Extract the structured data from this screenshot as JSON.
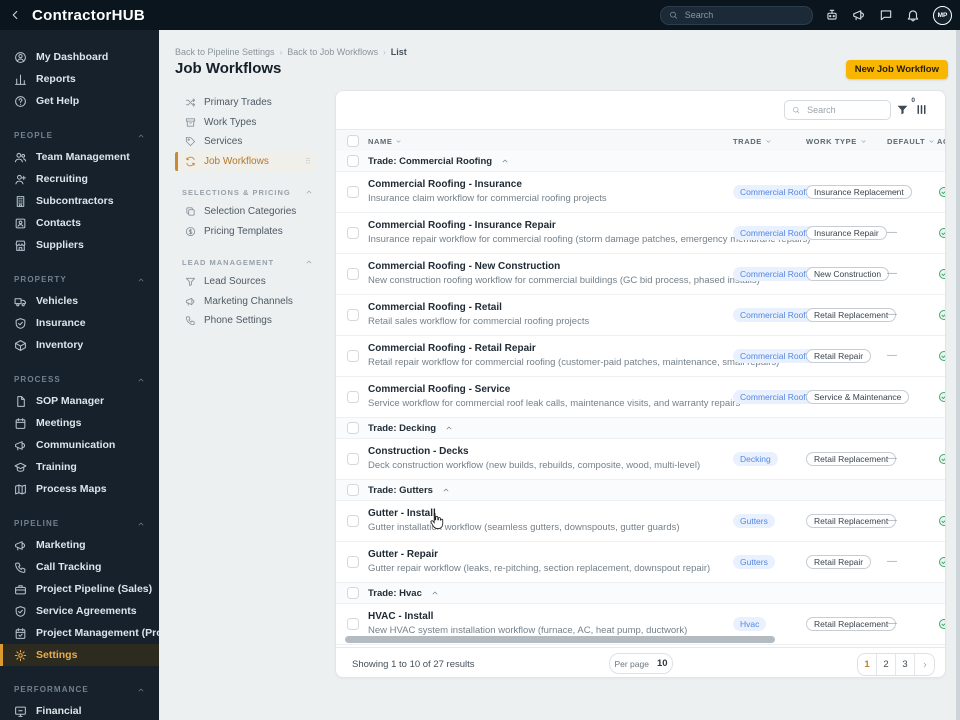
{
  "header": {
    "logo": "ContractorHUB",
    "search_placeholder": "Search",
    "icons": [
      "assistant-bot",
      "announcements",
      "chat",
      "notifications"
    ],
    "avatar_initials": "MP"
  },
  "sidebar": {
    "top_items": [
      {
        "icon": "user-circle",
        "label": "My Dashboard"
      },
      {
        "icon": "bar-chart",
        "label": "Reports"
      },
      {
        "icon": "help-circle",
        "label": "Get Help"
      }
    ],
    "sections": [
      {
        "title": "PEOPLE",
        "items": [
          {
            "icon": "users",
            "label": "Team Management"
          },
          {
            "icon": "user-plus",
            "label": "Recruiting"
          },
          {
            "icon": "building",
            "label": "Subcontractors"
          },
          {
            "icon": "contacts",
            "label": "Contacts"
          },
          {
            "icon": "store",
            "label": "Suppliers"
          }
        ]
      },
      {
        "title": "PROPERTY",
        "items": [
          {
            "icon": "truck",
            "label": "Vehicles"
          },
          {
            "icon": "shield-check",
            "label": "Insurance"
          },
          {
            "icon": "box",
            "label": "Inventory"
          }
        ]
      },
      {
        "title": "PROCESS",
        "items": [
          {
            "icon": "file-text",
            "label": "SOP Manager"
          },
          {
            "icon": "calendar",
            "label": "Meetings"
          },
          {
            "icon": "megaphone",
            "label": "Communication"
          },
          {
            "icon": "grad-cap",
            "label": "Training"
          },
          {
            "icon": "map",
            "label": "Process Maps"
          }
        ]
      },
      {
        "title": "PIPELINE",
        "items": [
          {
            "icon": "megaphone",
            "label": "Marketing"
          },
          {
            "icon": "phone",
            "label": "Call Tracking"
          },
          {
            "icon": "briefcase",
            "label": "Project Pipeline (Sales)"
          },
          {
            "icon": "shield-check",
            "label": "Service Agreements"
          },
          {
            "icon": "calendar-check",
            "label": "Project Management (Production)"
          },
          {
            "icon": "gear",
            "label": "Settings",
            "active": true
          }
        ]
      },
      {
        "title": "PERFORMANCE",
        "items": [
          {
            "icon": "monitor",
            "label": "Financial"
          }
        ]
      }
    ]
  },
  "subnav": {
    "breadcrumb": [
      "Back to Pipeline Settings",
      "Back to Job Workflows",
      "List"
    ],
    "title": "Job Workflows",
    "items": [
      {
        "icon": "shuffle",
        "label": "Primary Trades"
      },
      {
        "icon": "archive",
        "label": "Work Types"
      },
      {
        "icon": "tag",
        "label": "Services"
      },
      {
        "icon": "refresh",
        "label": "Job Workflows",
        "active": true
      }
    ],
    "sections": [
      {
        "title": "SELECTIONS & PRICING",
        "items": [
          {
            "icon": "copy",
            "label": "Selection Categories"
          },
          {
            "icon": "dollar-circle",
            "label": "Pricing Templates"
          }
        ]
      },
      {
        "title": "LEAD MANAGEMENT",
        "items": [
          {
            "icon": "funnel",
            "label": "Lead Sources"
          },
          {
            "icon": "megaphone",
            "label": "Marketing Channels"
          },
          {
            "icon": "phone",
            "label": "Phone Settings"
          }
        ]
      }
    ]
  },
  "main": {
    "new_button_label": "New Job Workflow",
    "table": {
      "search_placeholder": "Search",
      "filter_badge": "0",
      "columns": [
        "NAME",
        "TRADE",
        "WORK TYPE",
        "DEFAULT",
        "ACTIVE"
      ],
      "rows": [
        {
          "type": "group",
          "label": "Trade: Commercial Roofing"
        },
        {
          "type": "data",
          "title": "Commercial Roofing - Insurance",
          "description": "Insurance claim workflow for commercial roofing projects",
          "trade": "Commercial Roofing",
          "work_type": "Insurance Replacement",
          "default": "—",
          "active": true
        },
        {
          "type": "data",
          "title": "Commercial Roofing - Insurance Repair",
          "description": "Insurance repair workflow for commercial roofing (storm damage patches, emergency membrane repairs)",
          "trade": "Commercial Roofing",
          "work_type": "Insurance Repair",
          "default": "—",
          "active": true
        },
        {
          "type": "data",
          "title": "Commercial Roofing - New Construction",
          "description": "New construction roofing workflow for commercial buildings (GC bid process, phased installs)",
          "trade": "Commercial Roofing",
          "work_type": "New Construction",
          "default": "—",
          "active": true
        },
        {
          "type": "data",
          "title": "Commercial Roofing - Retail",
          "description": "Retail sales workflow for commercial roofing projects",
          "trade": "Commercial Roofing",
          "work_type": "Retail Replacement",
          "default": "—",
          "active": true
        },
        {
          "type": "data",
          "title": "Commercial Roofing - Retail Repair",
          "description": "Retail repair workflow for commercial roofing (customer-paid patches, maintenance, small repairs)",
          "trade": "Commercial Roofing",
          "work_type": "Retail Repair",
          "default": "—",
          "active": true
        },
        {
          "type": "data",
          "title": "Commercial Roofing - Service",
          "description": "Service workflow for commercial roof leak calls, maintenance visits, and warranty repairs",
          "trade": "Commercial Roofing",
          "work_type": "Service & Maintenance",
          "default": "—",
          "active": true
        },
        {
          "type": "group",
          "label": "Trade: Decking"
        },
        {
          "type": "data",
          "title": "Construction - Decks",
          "description": "Deck construction workflow (new builds, rebuilds, composite, wood, multi-level)",
          "trade": "Decking",
          "work_type": "Retail Replacement",
          "default": "—",
          "active": true
        },
        {
          "type": "group",
          "label": "Trade: Gutters"
        },
        {
          "type": "data",
          "title": "Gutter - Install",
          "description": "Gutter installation workflow (seamless gutters, downspouts, gutter guards)",
          "trade": "Gutters",
          "work_type": "Retail Replacement",
          "default": "—",
          "active": true
        },
        {
          "type": "data",
          "title": "Gutter - Repair",
          "description": "Gutter repair workflow (leaks, re-pitching, section replacement, downspout repair)",
          "trade": "Gutters",
          "work_type": "Retail Repair",
          "default": "—",
          "active": true
        },
        {
          "type": "group",
          "label": "Trade: Hvac"
        },
        {
          "type": "data",
          "title": "HVAC - Install",
          "description": "New HVAC system installation workflow (furnace, AC, heat pump, ductwork)",
          "trade": "Hvac",
          "work_type": "Retail Replacement",
          "default": "—",
          "active": true
        }
      ]
    },
    "footer": {
      "summary": "Showing 1 to 10 of 27 results",
      "per_page_label": "Per page",
      "per_page_value": "10",
      "pages": [
        "1",
        "2",
        "3"
      ],
      "active_page": "1"
    }
  },
  "colors": {
    "topbar_bg": "#0A151E",
    "sidebar_bg": "#16212C",
    "button_yellow": "#F8B502",
    "accent_orange": "#C98A35",
    "trade_badge_bg": "#E9F1FE",
    "trade_badge_text": "#5486E4",
    "active_green": "#44A56D"
  }
}
